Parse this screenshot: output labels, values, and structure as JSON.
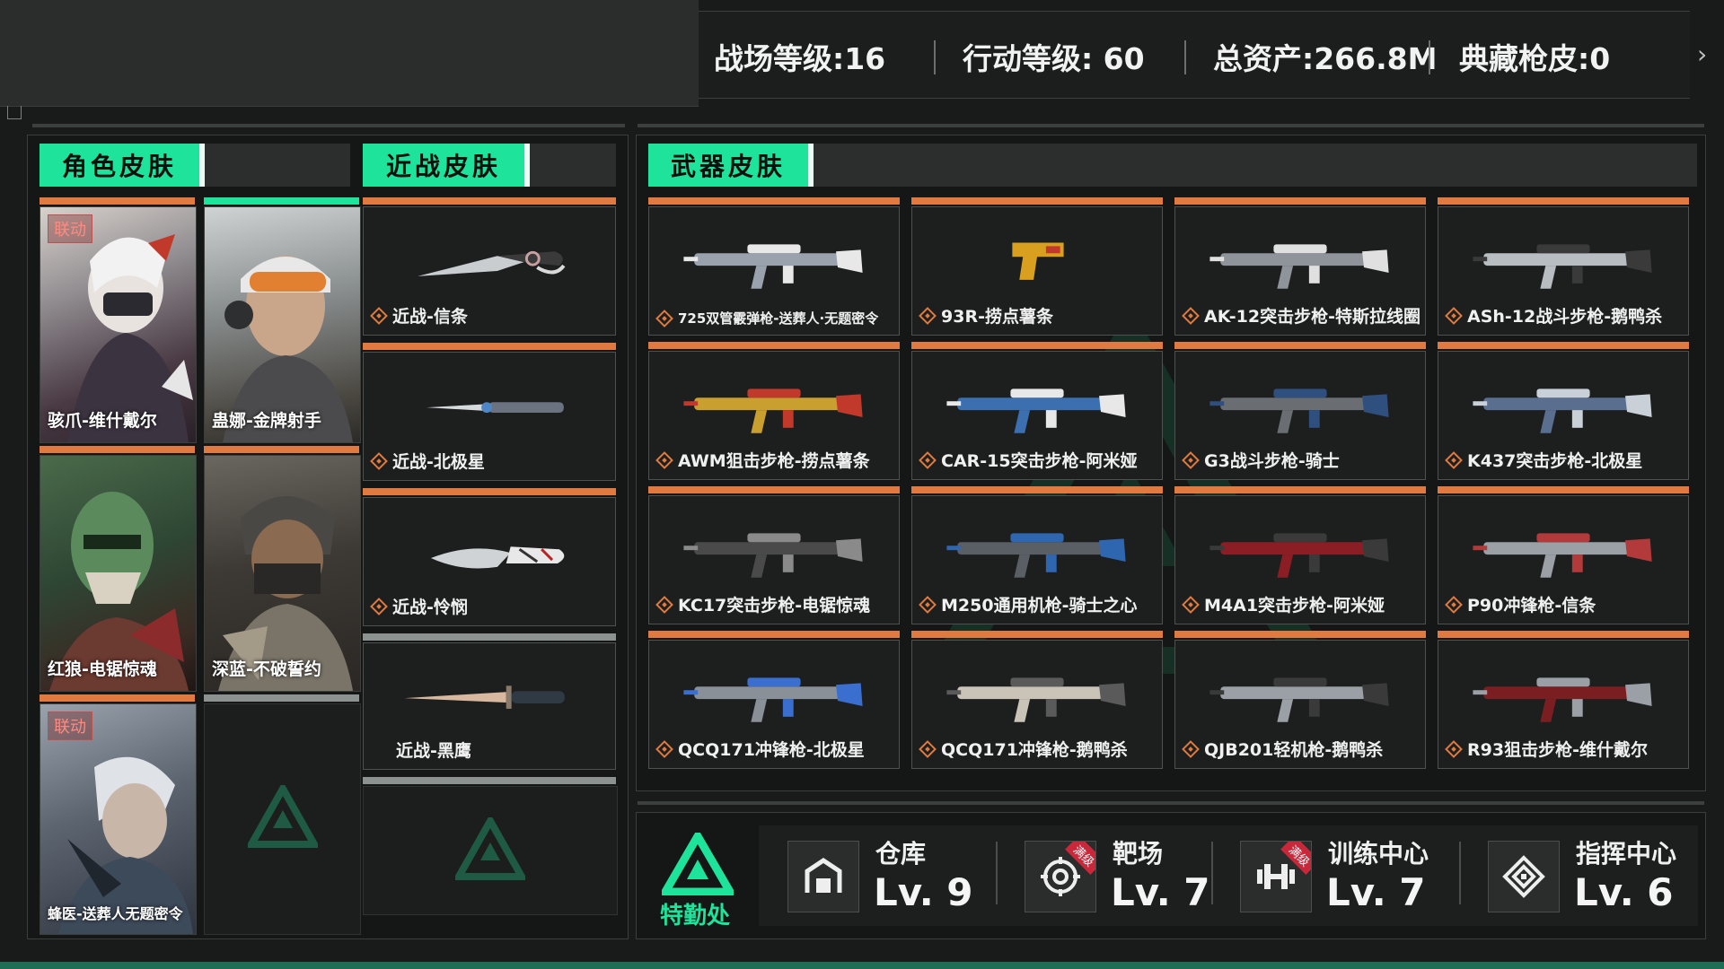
{
  "header": {
    "stats": [
      {
        "label": "战场等级:16"
      },
      {
        "label": "行动等级: 60"
      },
      {
        "label": "总资产:266.8M"
      },
      {
        "label": "典藏枪皮:0"
      }
    ],
    "next_arrow": "›"
  },
  "character_skins": {
    "tab": "角色皮肤",
    "collab_badge": "联动",
    "items": [
      {
        "name": "骇爪-维什戴尔",
        "collab": true
      },
      {
        "name": "蛊娜-金牌射手",
        "collab": false
      },
      {
        "name": "红狼-电锯惊魂",
        "collab": false
      },
      {
        "name": "深蓝-不破誓约",
        "collab": false
      },
      {
        "name": "蜂医-送葬人无题密令",
        "collab": true
      }
    ]
  },
  "melee_skins": {
    "tab": "近战皮肤",
    "items": [
      {
        "name": "近战-信条"
      },
      {
        "name": "近战-北极星"
      },
      {
        "name": "近战-怜悯"
      },
      {
        "name": "近战-黑鹰"
      }
    ]
  },
  "weapon_skins": {
    "tab": "武器皮肤",
    "items": [
      {
        "name": "725双管霰弹枪-送葬人·无题密令"
      },
      {
        "name": "93R-捞点薯条"
      },
      {
        "name": "AK-12突击步枪-特斯拉线圈"
      },
      {
        "name": "ASh-12战斗步枪-鹅鸭杀"
      },
      {
        "name": "AWM狙击步枪-捞点薯条"
      },
      {
        "name": "CAR-15突击步枪-阿米娅"
      },
      {
        "name": "G3战斗步枪-骑士"
      },
      {
        "name": "K437突击步枪-北极星"
      },
      {
        "name": "KC17突击步枪-电锯惊魂"
      },
      {
        "name": "M250通用机枪-骑士之心"
      },
      {
        "name": "M4A1突击步枪-阿米娅"
      },
      {
        "name": "P90冲锋枪-信条"
      },
      {
        "name": "QCQ171冲锋枪-北极星"
      },
      {
        "name": "QCQ171冲锋枪-鹅鸭杀"
      },
      {
        "name": "QJB201轻机枪-鹅鸭杀"
      },
      {
        "name": "R93狙击步枪-维什戴尔"
      }
    ]
  },
  "facilities": {
    "logo_label": "特勤处",
    "maxed_badge": "满级",
    "items": [
      {
        "name": "仓库",
        "level": "Lv. 9",
        "icon": "warehouse-icon",
        "maxed": false
      },
      {
        "name": "靶场",
        "level": "Lv. 7",
        "icon": "target-icon",
        "maxed": true
      },
      {
        "name": "训练中心",
        "level": "Lv. 7",
        "icon": "dumbbell-icon",
        "maxed": true
      },
      {
        "name": "指挥中心",
        "level": "Lv. 6",
        "icon": "command-icon",
        "maxed": false
      }
    ]
  },
  "colors": {
    "accent_green": "#1ee39a",
    "accent_orange": "#e07a40",
    "maxed_red": "#c9283b"
  }
}
